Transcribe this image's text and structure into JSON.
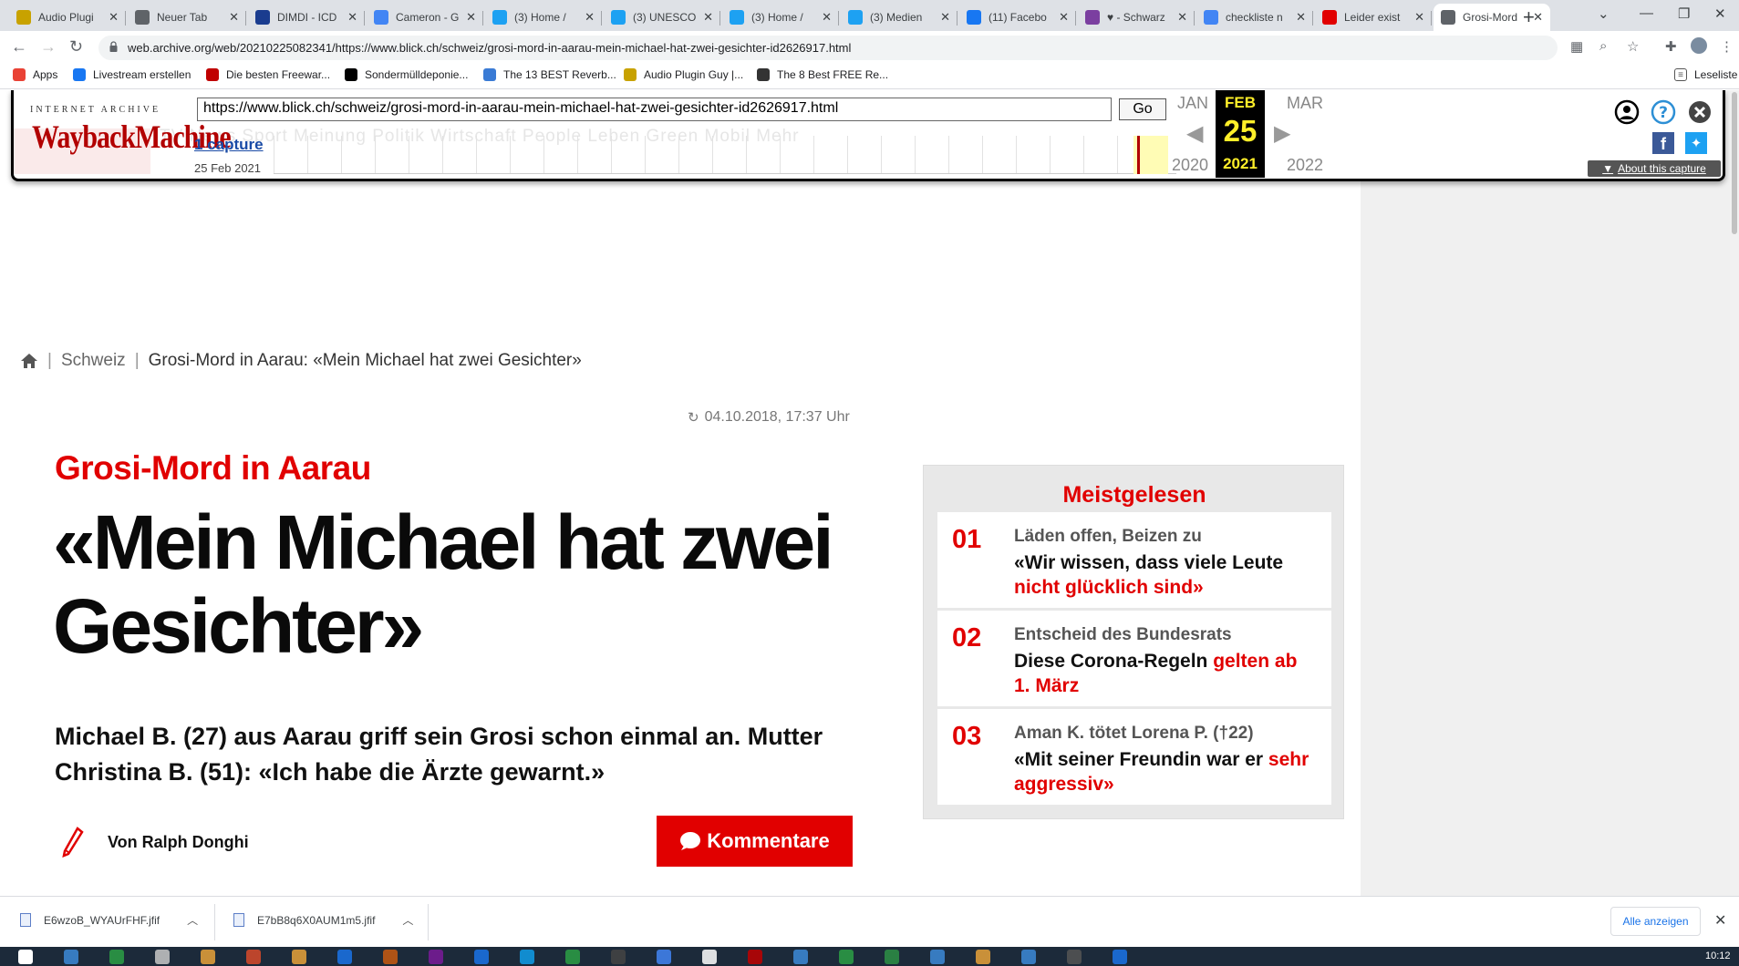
{
  "tabs": [
    {
      "title": "Audio Plugi",
      "icon": "plugin-guy-icon",
      "color": "#c8a200"
    },
    {
      "title": "Neuer Tab",
      "icon": "chrome-icon",
      "color": "#5f6368"
    },
    {
      "title": "DIMDI - ICD",
      "icon": "dimdi-icon",
      "color": "#1a3c8f"
    },
    {
      "title": "Cameron - G",
      "icon": "google-icon",
      "color": "#4285f4"
    },
    {
      "title": "(3) Home /",
      "icon": "twitter-icon",
      "color": "#1da1f2"
    },
    {
      "title": "(3) UNESCO",
      "icon": "twitter-icon",
      "color": "#1da1f2"
    },
    {
      "title": "(3) Home /",
      "icon": "twitter-icon",
      "color": "#1da1f2"
    },
    {
      "title": "(3) Medien",
      "icon": "twitter-icon",
      "color": "#1da1f2"
    },
    {
      "title": "(11) Facebo",
      "icon": "facebook-icon",
      "color": "#1877f2"
    },
    {
      "title": "♥ - Schwarz",
      "icon": "ut-icon",
      "color": "#7b3fa0"
    },
    {
      "title": "checkliste n",
      "icon": "google-icon",
      "color": "#4285f4"
    },
    {
      "title": "Leider exist",
      "icon": "blick-icon",
      "color": "#e10000"
    },
    {
      "title": "Grosi-Mord",
      "icon": "globe-icon",
      "color": "#5f6368"
    }
  ],
  "address": {
    "url": "web.archive.org/web/20210225082341/https://www.blick.ch/schweiz/grosi-mord-in-aarau-mein-michael-hat-zwei-gesichter-id2626917.html"
  },
  "bookmarks": [
    {
      "label": "Apps",
      "icon": "apps-grid-icon",
      "color": "#e94235"
    },
    {
      "label": "Livestream erstellen",
      "icon": "facebook-icon",
      "color": "#1877f2"
    },
    {
      "label": "Die besten Freewar...",
      "icon": "star-icon",
      "color": "#c00000"
    },
    {
      "label": "Sondermülldeponie...",
      "icon": "wikipedia-icon",
      "color": "#000000"
    },
    {
      "label": "The 13 BEST Reverb...",
      "icon": "reverb-icon",
      "color": "#3a7bd5"
    },
    {
      "label": "Audio Plugin Guy |...",
      "icon": "plugin-guy-icon",
      "color": "#c8a200"
    },
    {
      "label": "The 8 Best FREE Re...",
      "icon": "moon-icon",
      "color": "#333333"
    }
  ],
  "bookmarks_right": "Leseliste",
  "wayback": {
    "logo_top": "INTERNET ARCHIVE",
    "logo": "WaybackMachine",
    "url": "https://www.blick.ch/schweiz/grosi-mord-in-aarau-mein-michael-hat-zwei-gesichter-id2626917.html",
    "go": "Go",
    "captures": "1 capture",
    "capture_date": "25 Feb 2021",
    "prev_month": "JAN",
    "month": "FEB",
    "next_month": "MAR",
    "day": "25",
    "prev_year": "2020",
    "year": "2021",
    "next_year": "2022",
    "about": "About this capture",
    "ghost_nav": "TV    News    Sport    Meinung    Politik    Wirtschaft    People    Leben    Green    Mobil    Mehr"
  },
  "breadcrumb": {
    "section": "Schweiz",
    "current": "Grosi-Mord in Aarau: «Mein Michael hat zwei Gesichter»"
  },
  "article": {
    "timestamp": "04.10.2018, 17:37 Uhr",
    "kicker": "Grosi-Mord in Aarau",
    "headline": "«Mein Michael hat zwei Gesichter»",
    "lead": "Michael B. (27) aus Aarau griff sein Grosi schon einmal an. Mutter Christina B. (51): «Ich habe die Ärzte gewarnt.»",
    "author": "Von Ralph Donghi",
    "comments": "Kommentare"
  },
  "mostread": {
    "title": "Meistgelesen",
    "items": [
      {
        "num": "01",
        "kicker": "Läden offen, Beizen zu",
        "head_black": "«Wir wissen, dass viele Leute ",
        "head_red": "nicht glücklich sind»"
      },
      {
        "num": "02",
        "kicker": "Entscheid des Bundesrats",
        "head_black": "Diese Corona-Regeln ",
        "head_red": "gelten ab 1. März"
      },
      {
        "num": "03",
        "kicker": "Aman K. tötet Lorena P. (†22)",
        "head_black": "«Mit seiner Freundin war er ",
        "head_red": "sehr aggressiv»"
      }
    ]
  },
  "downloads": [
    {
      "name": "E6wzoB_WYAUrFHF.jfif"
    },
    {
      "name": "E7bB8q6X0AUM1m5.jfif"
    }
  ],
  "downloads_all": "Alle anzeigen",
  "clock": "10:12"
}
